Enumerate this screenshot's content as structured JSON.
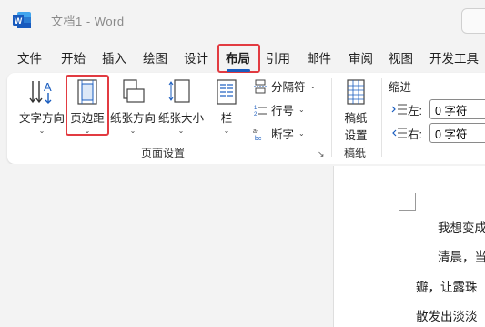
{
  "app": {
    "logo_letter": "W",
    "title": "文档1  -  Word"
  },
  "menu": {
    "tabs": [
      "文件",
      "开始",
      "插入",
      "绘图",
      "设计",
      "布局",
      "引用",
      "邮件",
      "审阅",
      "视图",
      "开发工具"
    ],
    "active_tab": "布局"
  },
  "ribbon": {
    "page_setup": {
      "text_direction": "文字方向",
      "margins": "页边距",
      "orientation": "纸张方向",
      "size": "纸张大小",
      "columns": "栏",
      "breaks": "分隔符",
      "line_numbers": "行号",
      "hyphenation": "断字",
      "group_label": "页面设置"
    },
    "manuscript": {
      "settings_line1": "稿纸",
      "settings_line2": "设置",
      "group_label": "稿纸"
    },
    "indent": {
      "title": "缩进",
      "left_label": "左:",
      "left_value": "0 字符",
      "right_label": "右:",
      "right_value": "0 字符"
    }
  },
  "document": {
    "lines": [
      "我想变成",
      "清晨，当",
      "瓣，让露珠",
      "散发出淡淡"
    ]
  },
  "colors": {
    "highlight": "#e23b41",
    "word_blue": "#185abd",
    "active_underline": "#1a5dbf"
  }
}
